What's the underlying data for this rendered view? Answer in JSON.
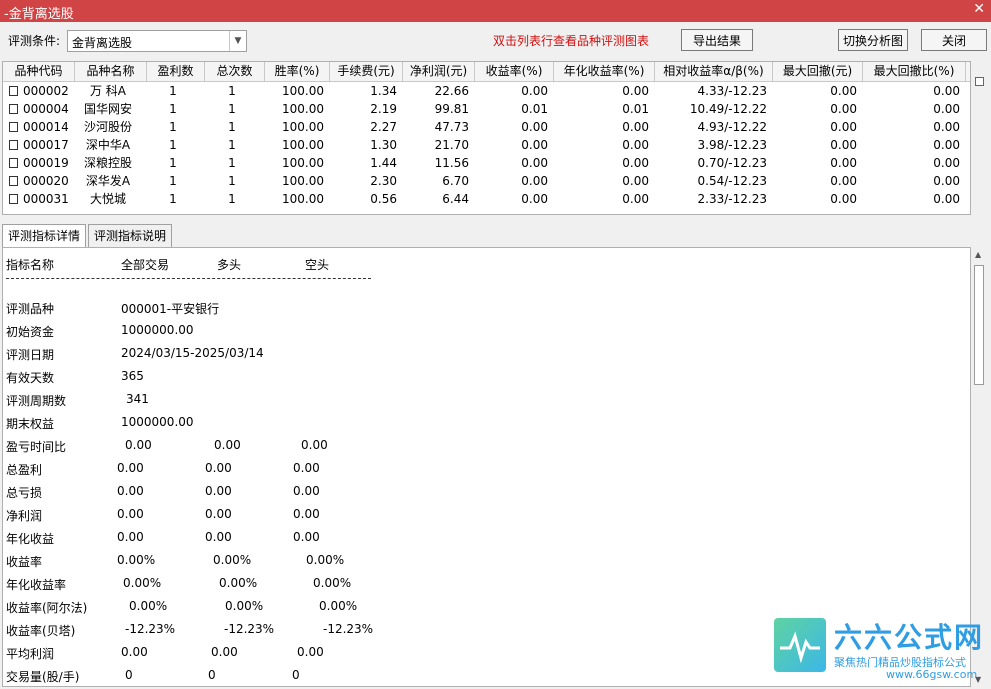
{
  "window": {
    "title": "-金背离选股",
    "close_glyph": "✕"
  },
  "toolbar": {
    "condition_label": "评测条件:",
    "condition_value": "金背离选股",
    "hint": "双击列表行查看品种评测图表",
    "export_label": "导出结果",
    "switch_label": "切换分析图",
    "close_label": "关闭"
  },
  "table": {
    "columns": [
      "品种代码",
      "品种名称",
      "盈利数",
      "总次数",
      "胜率(%)",
      "手续费(元)",
      "净利润(元)",
      "收益率(%)",
      "年化收益率(%)",
      "相对收益率α/β(%)",
      "最大回撤(元)",
      "最大回撤比(%)"
    ],
    "rows": [
      [
        "000002",
        "万 科A",
        "1",
        "1",
        "100.00",
        "1.34",
        "22.66",
        "0.00",
        "0.00",
        "4.33/-12.23",
        "0.00",
        "0.00"
      ],
      [
        "000004",
        "国华网安",
        "1",
        "1",
        "100.00",
        "2.19",
        "99.81",
        "0.01",
        "0.01",
        "10.49/-12.22",
        "0.00",
        "0.00"
      ],
      [
        "000014",
        "沙河股份",
        "1",
        "1",
        "100.00",
        "2.27",
        "47.73",
        "0.00",
        "0.00",
        "4.93/-12.22",
        "0.00",
        "0.00"
      ],
      [
        "000017",
        "深中华A",
        "1",
        "1",
        "100.00",
        "1.30",
        "21.70",
        "0.00",
        "0.00",
        "3.98/-12.23",
        "0.00",
        "0.00"
      ],
      [
        "000019",
        "深粮控股",
        "1",
        "1",
        "100.00",
        "1.44",
        "11.56",
        "0.00",
        "0.00",
        "0.70/-12.23",
        "0.00",
        "0.00"
      ],
      [
        "000020",
        "深华发A",
        "1",
        "1",
        "100.00",
        "2.30",
        "6.70",
        "0.00",
        "0.00",
        "0.54/-12.23",
        "0.00",
        "0.00"
      ],
      [
        "000031",
        "大悦城",
        "1",
        "1",
        "100.00",
        "0.56",
        "6.44",
        "0.00",
        "0.00",
        "2.33/-12.23",
        "0.00",
        "0.00"
      ]
    ]
  },
  "tabs": [
    "评测指标详情",
    "评测指标说明"
  ],
  "detail": {
    "header": [
      "指标名称",
      "全部交易",
      "多头",
      "空头"
    ],
    "info": [
      {
        "label": "评测品种",
        "value": "000001-平安银行"
      },
      {
        "label": "初始资金",
        "value": "1000000.00"
      },
      {
        "label": "评测日期",
        "value": "2024/03/15-2025/03/14"
      },
      {
        "label": "有效天数",
        "value": "365"
      },
      {
        "label": "评测周期数",
        "value": "341"
      },
      {
        "label": "期末权益",
        "value": "1000000.00"
      }
    ],
    "metrics": [
      {
        "label": "盈亏时间比",
        "all": "0.00",
        "long": "0.00",
        "short": "0.00"
      },
      {
        "label": "总盈利",
        "all": "0.00",
        "long": "0.00",
        "short": "0.00"
      },
      {
        "label": "总亏损",
        "all": "0.00",
        "long": "0.00",
        "short": "0.00"
      },
      {
        "label": "净利润",
        "all": "0.00",
        "long": "0.00",
        "short": "0.00"
      },
      {
        "label": "年化收益",
        "all": "0.00",
        "long": "0.00",
        "short": "0.00"
      },
      {
        "label": "收益率",
        "all": "0.00%",
        "long": "0.00%",
        "short": "0.00%"
      },
      {
        "label": "年化收益率",
        "all": "0.00%",
        "long": "0.00%",
        "short": "0.00%"
      },
      {
        "label": "收益率(阿尔法)",
        "all": "0.00%",
        "long": "0.00%",
        "short": "0.00%"
      },
      {
        "label": "收益率(贝塔)",
        "all": "-12.23%",
        "long": "-12.23%",
        "short": "-12.23%"
      },
      {
        "label": "平均利润",
        "all": "0.00",
        "long": "0.00",
        "short": "0.00"
      },
      {
        "label": "交易量(股/手)",
        "all": "0",
        "long": "0",
        "short": "0"
      }
    ]
  },
  "watermark": {
    "brand": "六六公式网",
    "slogan": "聚焦热门精品炒股指标公式",
    "url": "www.66gsw.com"
  }
}
